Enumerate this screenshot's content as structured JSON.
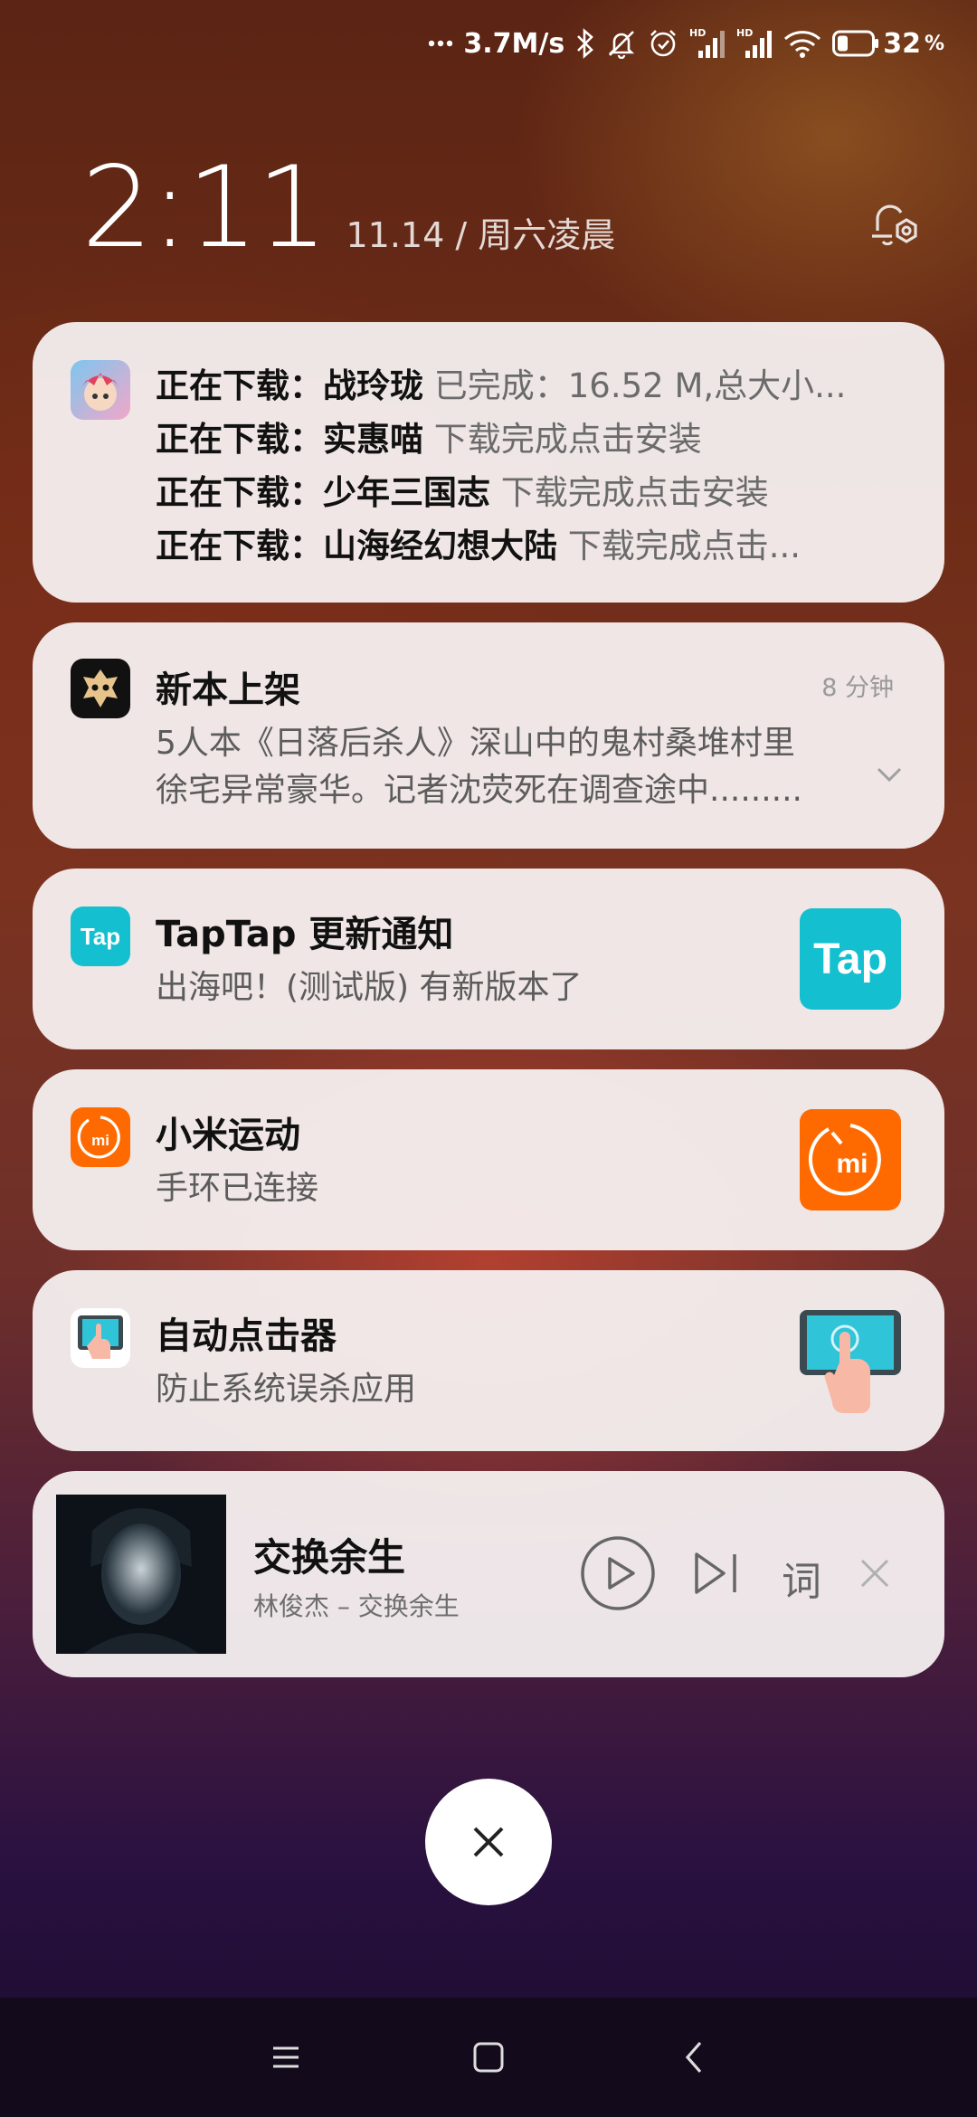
{
  "status_bar": {
    "net_speed": "3.7M/s",
    "battery_percent": "32",
    "battery_unit": "%",
    "hd_label": "HD",
    "icons": [
      "dots-icon",
      "bluetooth-icon",
      "mute-bell-icon",
      "alarm-icon",
      "signal-hd-icon",
      "signal-hd-icon",
      "wifi-icon",
      "battery-icon"
    ],
    "battery_level": 0.32
  },
  "lockscreen": {
    "time": "2:11",
    "date": "11.14 / 周六凌晨"
  },
  "notifications": {
    "downloads": {
      "lines": [
        {
          "label": "正在下载：",
          "name": "战玲珑",
          "detail": "已完成：16.52 M,总大小..."
        },
        {
          "label": "正在下载：",
          "name": "实惠喵",
          "detail": "下载完成点击安装"
        },
        {
          "label": "正在下载：",
          "name": "少年三国志",
          "detail": "下载完成点击安装"
        },
        {
          "label": "正在下载：",
          "name": "山海经幻想大陆",
          "detail": "下载完成点击..."
        }
      ]
    },
    "new_book": {
      "title": "新本上架",
      "time": "8 分钟",
      "body_line1": "5人本《日落后杀人》深山中的鬼村桑堆村里",
      "body_line2": "徐宅异常豪华。记者沈荧死在调查途中........."
    },
    "taptap": {
      "title": "TapTap 更新通知",
      "body": "出海吧！(测试版) 有新版本了",
      "icon_text": "Tap",
      "brand_color": "#14bfd0"
    },
    "mi_fit": {
      "title": "小米运动",
      "body": "手环已连接",
      "icon_text": "mi",
      "brand_color": "#ff6a00"
    },
    "auto_clicker": {
      "title": "自动点击器",
      "body": "防止系统误杀应用"
    },
    "music": {
      "title": "交换余生",
      "artist_line": "林俊杰 – 交换余生",
      "lyrics_label": "词"
    }
  }
}
